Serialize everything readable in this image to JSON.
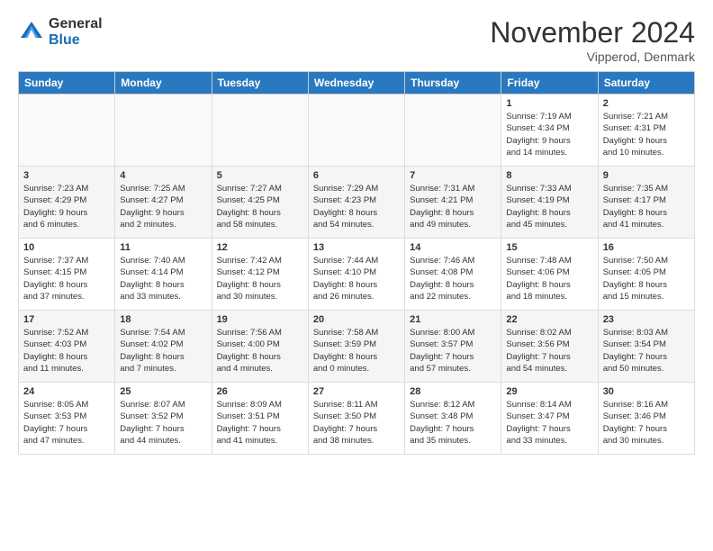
{
  "header": {
    "logo_line1": "General",
    "logo_line2": "Blue",
    "month_title": "November 2024",
    "location": "Vipperod, Denmark"
  },
  "weekdays": [
    "Sunday",
    "Monday",
    "Tuesday",
    "Wednesday",
    "Thursday",
    "Friday",
    "Saturday"
  ],
  "weeks": [
    [
      {
        "day": "",
        "info": ""
      },
      {
        "day": "",
        "info": ""
      },
      {
        "day": "",
        "info": ""
      },
      {
        "day": "",
        "info": ""
      },
      {
        "day": "",
        "info": ""
      },
      {
        "day": "1",
        "info": "Sunrise: 7:19 AM\nSunset: 4:34 PM\nDaylight: 9 hours\nand 14 minutes."
      },
      {
        "day": "2",
        "info": "Sunrise: 7:21 AM\nSunset: 4:31 PM\nDaylight: 9 hours\nand 10 minutes."
      }
    ],
    [
      {
        "day": "3",
        "info": "Sunrise: 7:23 AM\nSunset: 4:29 PM\nDaylight: 9 hours\nand 6 minutes."
      },
      {
        "day": "4",
        "info": "Sunrise: 7:25 AM\nSunset: 4:27 PM\nDaylight: 9 hours\nand 2 minutes."
      },
      {
        "day": "5",
        "info": "Sunrise: 7:27 AM\nSunset: 4:25 PM\nDaylight: 8 hours\nand 58 minutes."
      },
      {
        "day": "6",
        "info": "Sunrise: 7:29 AM\nSunset: 4:23 PM\nDaylight: 8 hours\nand 54 minutes."
      },
      {
        "day": "7",
        "info": "Sunrise: 7:31 AM\nSunset: 4:21 PM\nDaylight: 8 hours\nand 49 minutes."
      },
      {
        "day": "8",
        "info": "Sunrise: 7:33 AM\nSunset: 4:19 PM\nDaylight: 8 hours\nand 45 minutes."
      },
      {
        "day": "9",
        "info": "Sunrise: 7:35 AM\nSunset: 4:17 PM\nDaylight: 8 hours\nand 41 minutes."
      }
    ],
    [
      {
        "day": "10",
        "info": "Sunrise: 7:37 AM\nSunset: 4:15 PM\nDaylight: 8 hours\nand 37 minutes."
      },
      {
        "day": "11",
        "info": "Sunrise: 7:40 AM\nSunset: 4:14 PM\nDaylight: 8 hours\nand 33 minutes."
      },
      {
        "day": "12",
        "info": "Sunrise: 7:42 AM\nSunset: 4:12 PM\nDaylight: 8 hours\nand 30 minutes."
      },
      {
        "day": "13",
        "info": "Sunrise: 7:44 AM\nSunset: 4:10 PM\nDaylight: 8 hours\nand 26 minutes."
      },
      {
        "day": "14",
        "info": "Sunrise: 7:46 AM\nSunset: 4:08 PM\nDaylight: 8 hours\nand 22 minutes."
      },
      {
        "day": "15",
        "info": "Sunrise: 7:48 AM\nSunset: 4:06 PM\nDaylight: 8 hours\nand 18 minutes."
      },
      {
        "day": "16",
        "info": "Sunrise: 7:50 AM\nSunset: 4:05 PM\nDaylight: 8 hours\nand 15 minutes."
      }
    ],
    [
      {
        "day": "17",
        "info": "Sunrise: 7:52 AM\nSunset: 4:03 PM\nDaylight: 8 hours\nand 11 minutes."
      },
      {
        "day": "18",
        "info": "Sunrise: 7:54 AM\nSunset: 4:02 PM\nDaylight: 8 hours\nand 7 minutes."
      },
      {
        "day": "19",
        "info": "Sunrise: 7:56 AM\nSunset: 4:00 PM\nDaylight: 8 hours\nand 4 minutes."
      },
      {
        "day": "20",
        "info": "Sunrise: 7:58 AM\nSunset: 3:59 PM\nDaylight: 8 hours\nand 0 minutes."
      },
      {
        "day": "21",
        "info": "Sunrise: 8:00 AM\nSunset: 3:57 PM\nDaylight: 7 hours\nand 57 minutes."
      },
      {
        "day": "22",
        "info": "Sunrise: 8:02 AM\nSunset: 3:56 PM\nDaylight: 7 hours\nand 54 minutes."
      },
      {
        "day": "23",
        "info": "Sunrise: 8:03 AM\nSunset: 3:54 PM\nDaylight: 7 hours\nand 50 minutes."
      }
    ],
    [
      {
        "day": "24",
        "info": "Sunrise: 8:05 AM\nSunset: 3:53 PM\nDaylight: 7 hours\nand 47 minutes."
      },
      {
        "day": "25",
        "info": "Sunrise: 8:07 AM\nSunset: 3:52 PM\nDaylight: 7 hours\nand 44 minutes."
      },
      {
        "day": "26",
        "info": "Sunrise: 8:09 AM\nSunset: 3:51 PM\nDaylight: 7 hours\nand 41 minutes."
      },
      {
        "day": "27",
        "info": "Sunrise: 8:11 AM\nSunset: 3:50 PM\nDaylight: 7 hours\nand 38 minutes."
      },
      {
        "day": "28",
        "info": "Sunrise: 8:12 AM\nSunset: 3:48 PM\nDaylight: 7 hours\nand 35 minutes."
      },
      {
        "day": "29",
        "info": "Sunrise: 8:14 AM\nSunset: 3:47 PM\nDaylight: 7 hours\nand 33 minutes."
      },
      {
        "day": "30",
        "info": "Sunrise: 8:16 AM\nSunset: 3:46 PM\nDaylight: 7 hours\nand 30 minutes."
      }
    ]
  ]
}
